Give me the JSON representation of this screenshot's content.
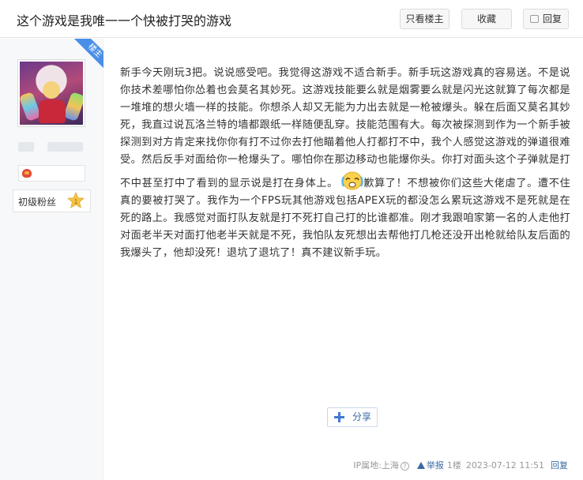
{
  "header": {
    "title": "这个游戏是我唯一一个快被打哭的游戏",
    "only_op_label": "只看楼主",
    "favorite_label": "收藏",
    "reply_label": "回复"
  },
  "author": {
    "op_badge": "楼主",
    "level_label": "初级粉丝",
    "level_number": "1"
  },
  "post": {
    "paragraph1": "新手今天刚玩3把。说说感受吧。我觉得这游戏不适合新手。新手玩这游戏真的容易送。不是说你技术差哪怕你怂着也会莫名其妙死。这游戏技能要么就是烟雾要么就是闪光这就算了每次都是一堆堆的想火墙一样的技能。你想杀人却又无能为力出去就是一枪被爆头。躲在后面又莫名其妙死，我直过说瓦洛兰特的墙都跟纸一样随便乱穿。技能范围有大。每次被探测到作为一个新手被探测到对方肯定来找你你有打不过你去打他瞄着他人打都打不中，我个人感觉这游戏的弹道很难受。然后反手对面给你一枪爆头了。哪怕你在那边移动也能爆你头。你打对面头这个子弹就是打不中甚至打中了看到的显示说是打在身体上。",
    "paragraph2": "歉算了！不想被你们这些大佬虐了。遭不住真的要被打哭了。我作为一个FPS玩其他游戏包括APEX玩的都没怎么累玩这游戏不是死就是在死的路上。我感觉对面打队友就是打不死打自己打的比谁都准。刚才我跟咱家第一名的人走他打对面老半天对面打他老半天就是不死，我怕队友死想出去帮他打几枪还没开出枪就给队友后面的我爆头了，他却没死！退坑了退坑了！真不建议新手玩。",
    "emoji": "crying-face-emoji"
  },
  "share": {
    "label": "分享"
  },
  "footer": {
    "ip_location": "IP属地:上海",
    "report_label": "举报",
    "floor": "1楼",
    "timestamp": "2023-07-12 11:51",
    "reply_label": "回复"
  },
  "colors": {
    "accent": "#3868a5",
    "op_ribbon": "#4a8fe7",
    "sidebar_bg": "#f7f8fa"
  }
}
